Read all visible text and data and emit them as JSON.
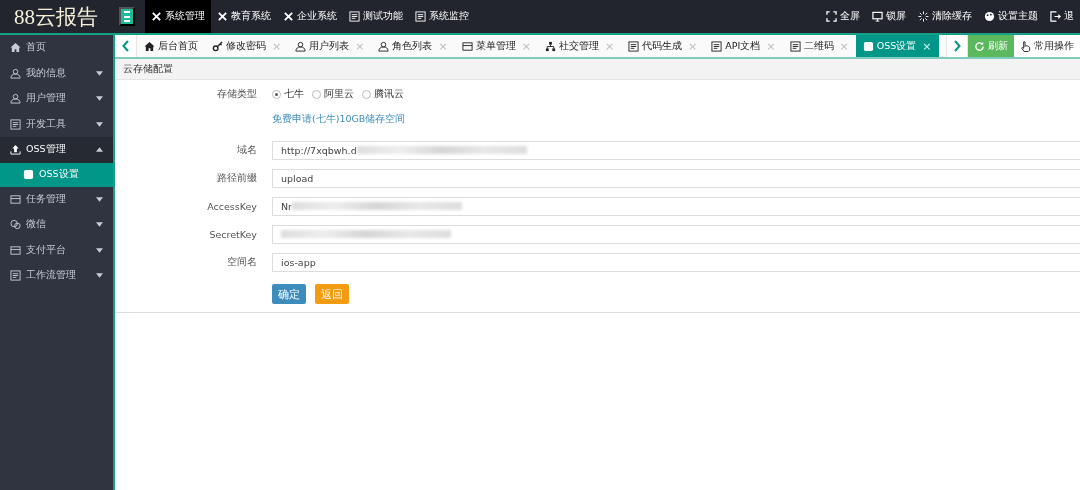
{
  "logo": "88云报告",
  "top_menu": [
    {
      "label": "系统管理",
      "selected": true
    },
    {
      "label": "教育系统",
      "selected": false
    },
    {
      "label": "企业系统",
      "selected": false
    },
    {
      "label": "测试功能",
      "selected": false
    },
    {
      "label": "系统监控",
      "selected": false
    }
  ],
  "top_actions": [
    "全屏",
    "锁屏",
    "清除缓存",
    "设置主题",
    "退"
  ],
  "sidebar": {
    "items": [
      {
        "label": "首页",
        "kind": "link",
        "expanded": false
      },
      {
        "label": "我的信息",
        "kind": "menu",
        "expanded": false
      },
      {
        "label": "用户管理",
        "kind": "menu",
        "expanded": false
      },
      {
        "label": "开发工具",
        "kind": "menu",
        "expanded": false
      },
      {
        "label": "OSS管理",
        "kind": "menu",
        "expanded": true,
        "children": [
          {
            "label": "OSS设置",
            "selected": true
          }
        ]
      },
      {
        "label": "任务管理",
        "kind": "menu",
        "expanded": false
      },
      {
        "label": "微信",
        "kind": "menu",
        "expanded": false
      },
      {
        "label": "支付平台",
        "kind": "menu",
        "expanded": false
      },
      {
        "label": "工作流管理",
        "kind": "menu",
        "expanded": false
      }
    ]
  },
  "tabs": [
    {
      "label": "后台首页",
      "selected": false
    },
    {
      "label": "修改密码",
      "close": "×",
      "selected": false
    },
    {
      "label": "用户列表",
      "close": "×",
      "selected": false
    },
    {
      "label": "角色列表",
      "close": "×",
      "selected": false
    },
    {
      "label": "菜单管理",
      "close": "×",
      "selected": false
    },
    {
      "label": "社交管理",
      "close": "×",
      "selected": false
    },
    {
      "label": "代码生成",
      "close": "×",
      "selected": false
    },
    {
      "label": "API文档",
      "close": "×",
      "selected": false
    },
    {
      "label": "二维码",
      "close": "×",
      "selected": false
    },
    {
      "label": "OSS设置",
      "close": "×",
      "selected": true
    }
  ],
  "tab_actions": {
    "refresh": "刷新",
    "common": "常用操作"
  },
  "panel": {
    "title": "云存储配置",
    "storage_type": {
      "label": "存储类型",
      "options": [
        {
          "label": "七牛",
          "selected": true
        },
        {
          "label": "阿里云",
          "selected": false
        },
        {
          "label": "腾讯云",
          "selected": false
        }
      ]
    },
    "promo_link": "免费申请(七牛)10GB储存空间",
    "fields": [
      {
        "label": "域名",
        "value": "http://7xqbwh.d",
        "blurred": true
      },
      {
        "label": "路径前缀",
        "value": "upload",
        "blurred": false
      },
      {
        "label": "AccessKey",
        "value": "Nr",
        "blurred": true
      },
      {
        "label": "SecretKey",
        "blurred": true
      },
      {
        "label": "空间名",
        "value": "ios-app",
        "blurred": false
      }
    ],
    "buttons": {
      "confirm": "确定",
      "back": "返回"
    }
  }
}
